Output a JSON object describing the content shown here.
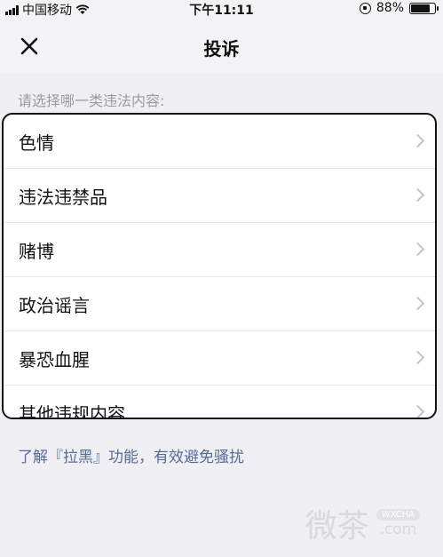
{
  "status_bar": {
    "carrier": "中国移动",
    "time": "下午11:11",
    "battery": "88%",
    "battery_level": 0.88
  },
  "nav": {
    "title": "投诉"
  },
  "prompt": "请选择哪一类违法内容:",
  "items": [
    {
      "label": "色情"
    },
    {
      "label": "违法违禁品"
    },
    {
      "label": "赌博"
    },
    {
      "label": "政治谣言"
    },
    {
      "label": "暴恐血腥"
    },
    {
      "label": "其他违规内容"
    }
  ],
  "blacklist_link": "了解『拉黑』功能，有效避免骚扰",
  "watermark": {
    "text": "微茶",
    "badge": "WXCHA",
    "domain": ".com"
  },
  "colors": {
    "link": "#576b95",
    "background": "#efeff4"
  }
}
